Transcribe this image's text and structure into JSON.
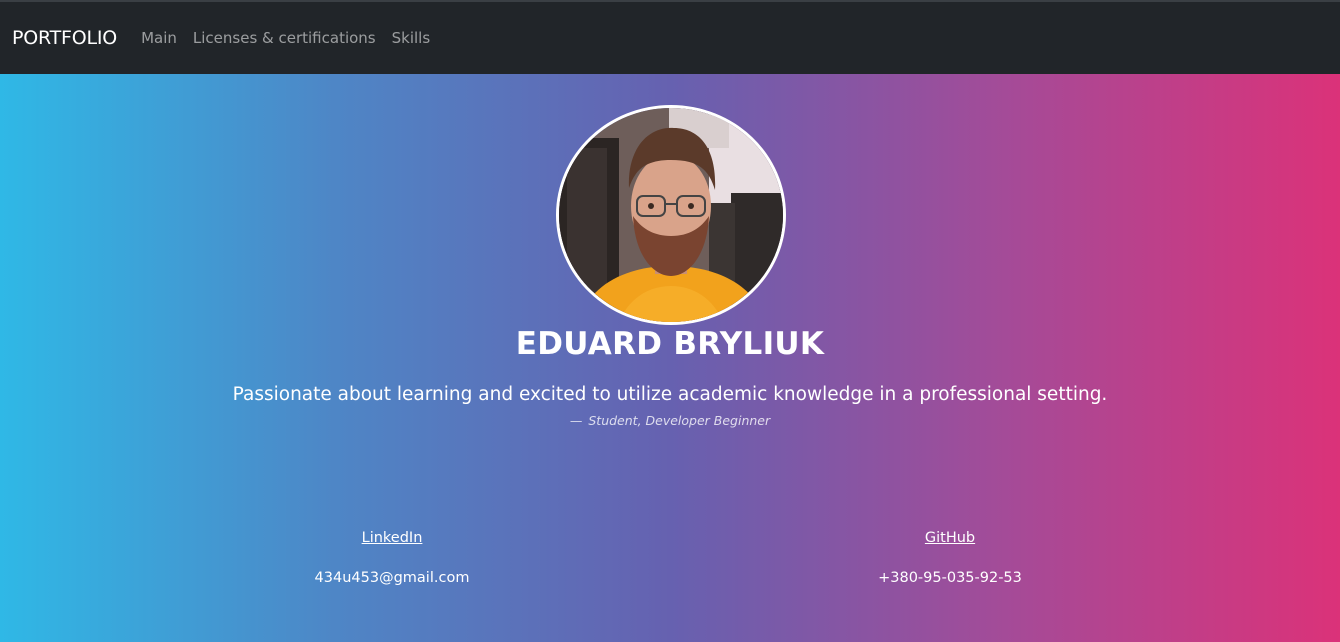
{
  "navbar": {
    "brand": "PORTFOLIO",
    "links": [
      "Main",
      "Licenses & certifications",
      "Skills"
    ]
  },
  "hero": {
    "avatar_alt": "Profile photo",
    "name": "EDUARD BRYLIUK",
    "quote": "Passionate about learning and excited to utilize academic knowledge in a professional setting.",
    "cite_dash": "—",
    "cite": "Student, Developer Beginner"
  },
  "contacts": {
    "linkedin": "LinkedIn",
    "github": "GitHub",
    "email": "434u453@gmail.com",
    "phone": "+380-95-035-92-53"
  },
  "colors": {
    "navbar_bg": "#212529",
    "gradient": [
      "#2fb8e6",
      "#6661b0",
      "#db3279"
    ],
    "text": "#ffffff"
  }
}
